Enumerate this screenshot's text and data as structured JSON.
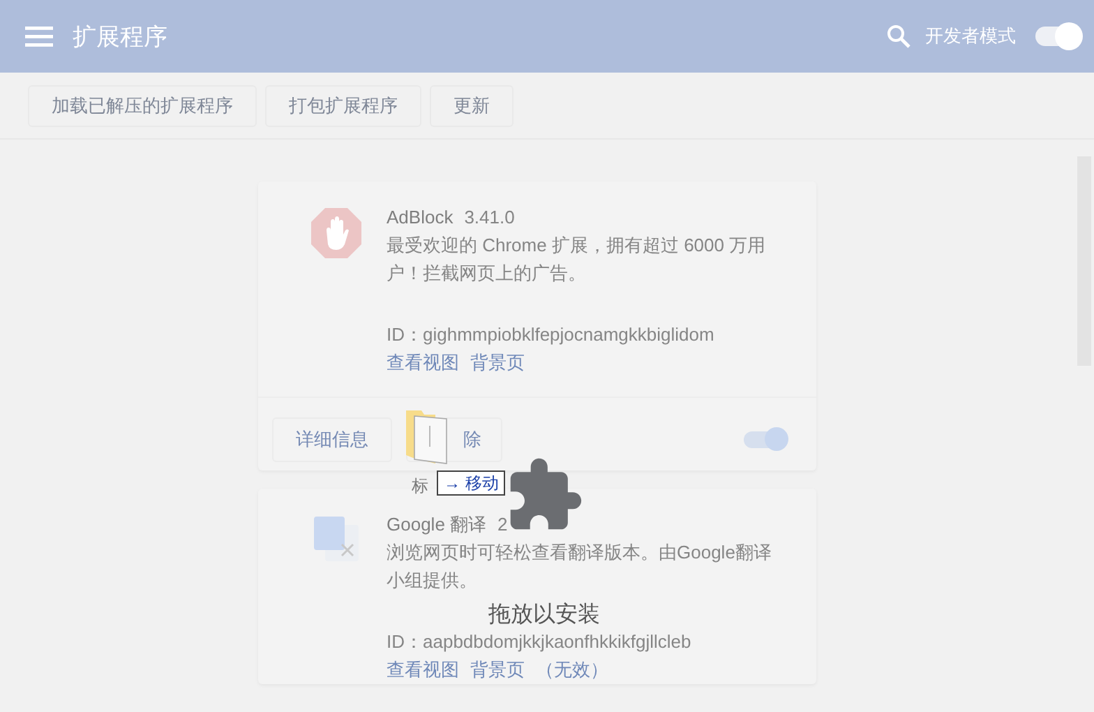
{
  "header": {
    "title": "扩展程序",
    "developer_mode": {
      "label": "开发者模式",
      "on": true
    }
  },
  "toolbar": {
    "buttons": [
      "加载已解压的扩展程序",
      "打包扩展程序",
      "更新"
    ]
  },
  "extensions": [
    {
      "name": "AdBlock",
      "version": "3.41.0",
      "description": "最受欢迎的 Chrome 扩展，拥有超过 6000 万用户！拦截网页上的广告。",
      "id": "ID：gighmmpiobklfepjocnamgkkbiglidom",
      "links": [
        "查看视图",
        "背景页"
      ],
      "buttons": [
        "详细信息",
        "除"
      ],
      "enabled": true
    },
    {
      "name": "Google 翻译",
      "version": "2",
      "description": "浏览网页时可轻松查看翻译版本。由Google翻译小组提供。",
      "id": "ID：aapbdbdomjkkjkaonfhkkikfgjllcleb",
      "links": [
        "查看视图",
        "背景页",
        "（无效）"
      ]
    }
  ],
  "drop_overlay": {
    "message": "拖放以安装"
  },
  "drag_cursor": {
    "label": "标",
    "effect": "→ 移动"
  }
}
